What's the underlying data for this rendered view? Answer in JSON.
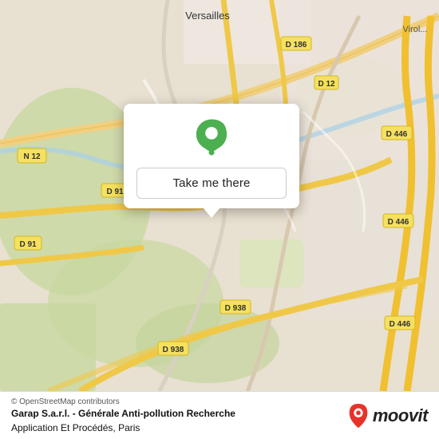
{
  "map": {
    "region": "Versailles, Paris",
    "city_label": "Versailles",
    "road_labels": [
      "N 12",
      "D 91",
      "D 91",
      "D 186",
      "D 12",
      "D 446",
      "D 446",
      "D 446",
      "D 938",
      "D 938"
    ]
  },
  "popup": {
    "take_me_there": "Take me there"
  },
  "footer": {
    "osm_credit": "© OpenStreetMap contributors",
    "place_name": "Garap S.a.r.l. - Générale Anti-pollution Recherche",
    "place_name2": "Application Et Procédés, Paris",
    "moovit_label": "moovit"
  }
}
